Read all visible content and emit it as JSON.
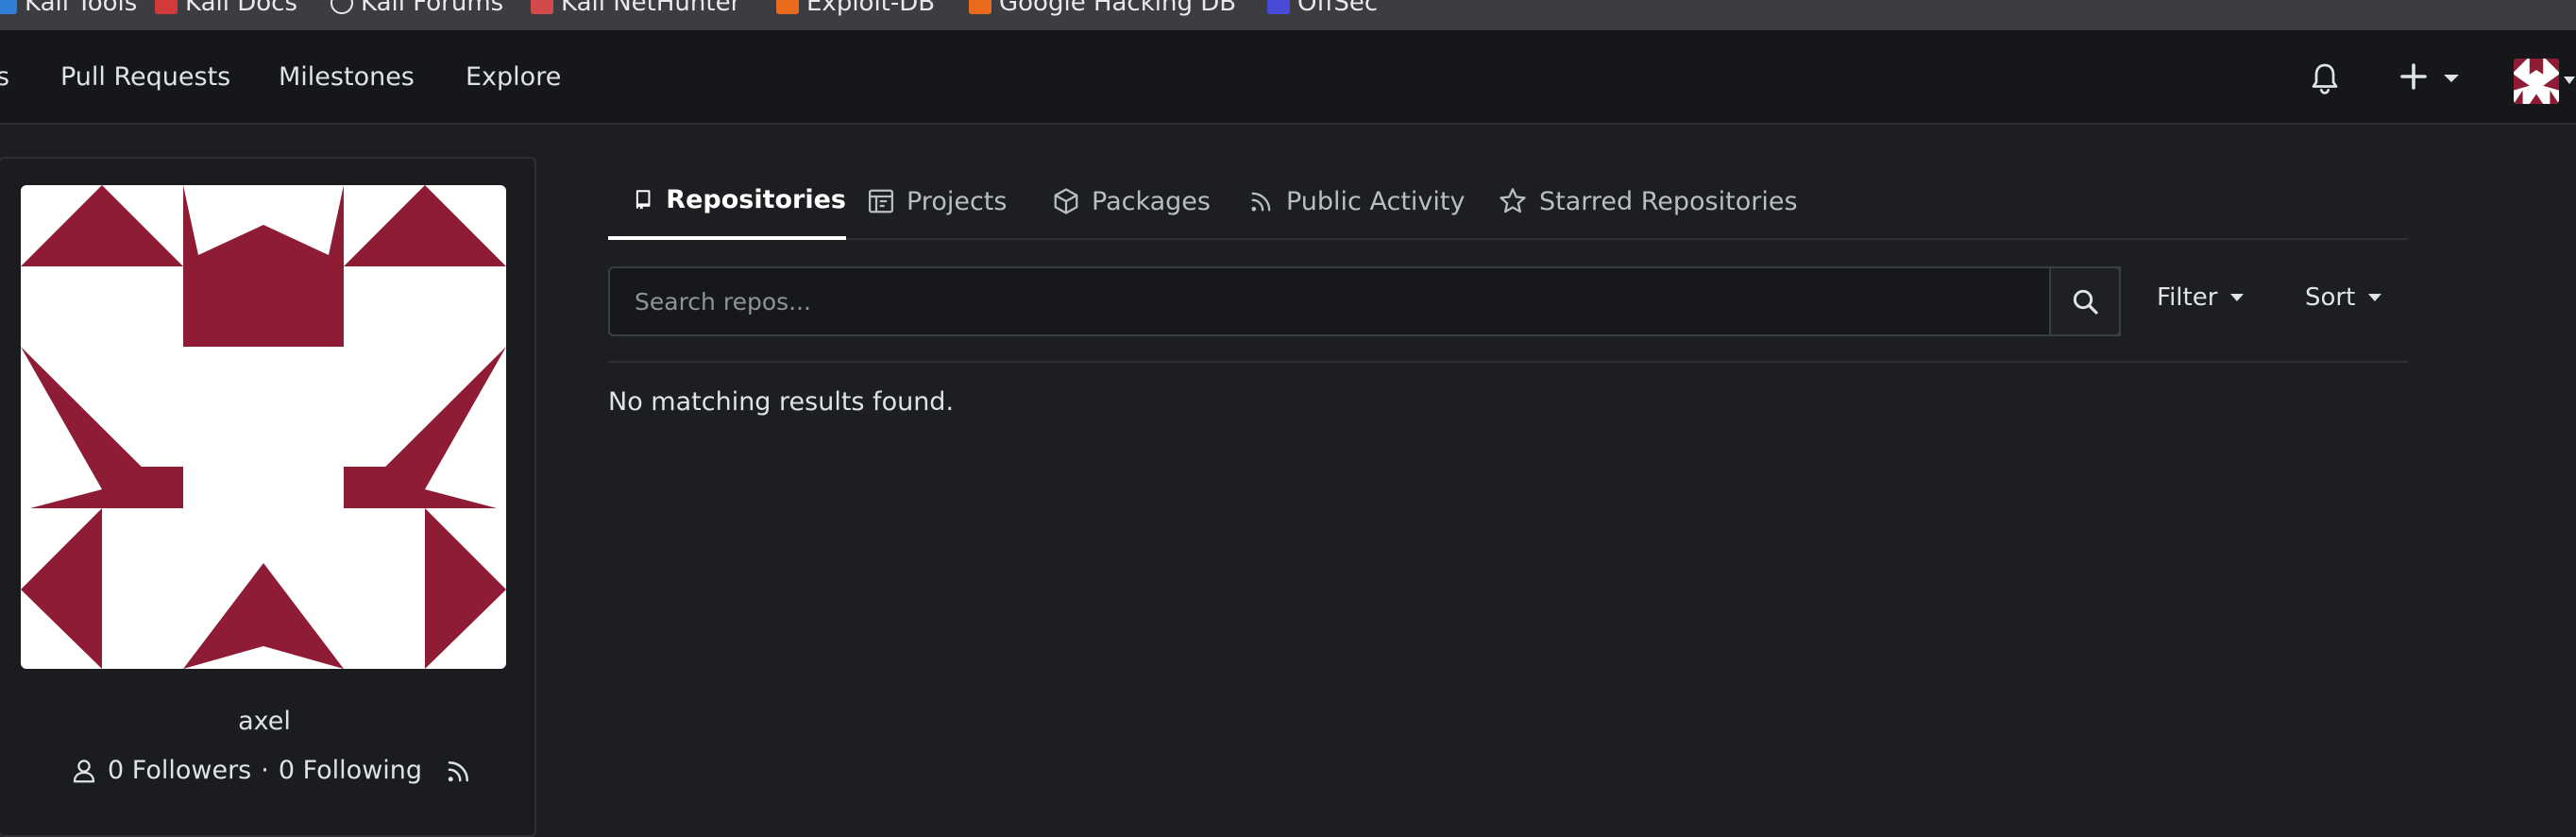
{
  "bookmarks": [
    {
      "label": "Kali Tools",
      "color": "#2f7fd8"
    },
    {
      "label": "Kali Docs",
      "color": "#d33a3a"
    },
    {
      "label": "Kali Forums",
      "color": "#2b2b2b"
    },
    {
      "label": "Kali NetHunter",
      "color": "#d34a4a"
    },
    {
      "label": "Exploit-DB",
      "color": "#e86a1a"
    },
    {
      "label": "Google Hacking DB",
      "color": "#e86a1a"
    },
    {
      "label": "OffSec",
      "color": "#4a4ad8"
    }
  ],
  "nav": {
    "left_fragment": "s",
    "items": [
      "Pull Requests",
      "Milestones",
      "Explore"
    ]
  },
  "profile": {
    "username": "axel",
    "followers": "0 Followers",
    "separator": "·",
    "following": "0 Following",
    "avatar_color": "#8e1c34"
  },
  "tabs": [
    {
      "label": "Repositories",
      "icon": "repo-icon",
      "active": true
    },
    {
      "label": "Projects",
      "icon": "project-icon",
      "active": false
    },
    {
      "label": "Packages",
      "icon": "package-icon",
      "active": false
    },
    {
      "label": "Public Activity",
      "icon": "rss-icon",
      "active": false
    },
    {
      "label": "Starred Repositories",
      "icon": "star-icon",
      "active": false
    }
  ],
  "search": {
    "placeholder": "Search repos..."
  },
  "filters": {
    "filter_label": "Filter",
    "sort_label": "Sort"
  },
  "results": {
    "empty_message": "No matching results found."
  }
}
